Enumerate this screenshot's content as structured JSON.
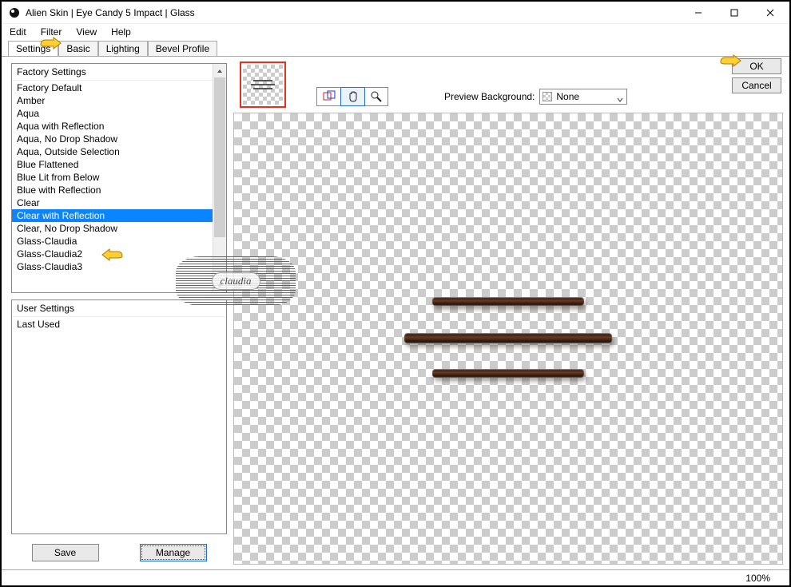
{
  "window": {
    "title": "Alien Skin | Eye Candy 5 Impact | Glass"
  },
  "menu": {
    "edit": "Edit",
    "filter": "Filter",
    "view": "View",
    "help": "Help"
  },
  "tabs": {
    "settings": "Settings",
    "basic": "Basic",
    "lighting": "Lighting",
    "bevel": "Bevel Profile"
  },
  "factory": {
    "header": "Factory Settings",
    "items": [
      "Factory Default",
      "Amber",
      "Aqua",
      "Aqua with Reflection",
      "Aqua, No Drop Shadow",
      "Aqua, Outside Selection",
      "Blue Flattened",
      "Blue Lit from Below",
      "Blue with Reflection",
      "Clear",
      "Clear with Reflection",
      "Clear, No Drop Shadow",
      "Glass-Claudia",
      "Glass-Claudia2",
      "Glass-Claudia3"
    ],
    "selected_index": 10
  },
  "user": {
    "header": "User Settings",
    "items": [
      "Last Used"
    ]
  },
  "buttons": {
    "save": "Save",
    "manage": "Manage",
    "ok": "OK",
    "cancel": "Cancel"
  },
  "preview": {
    "bg_label": "Preview Background:",
    "bg_value": "None"
  },
  "status": {
    "zoom": "100%"
  },
  "icons": {
    "nav": "navigator-icon",
    "hand": "hand-tool-icon",
    "zoom": "zoom-tool-icon"
  },
  "watermark": {
    "text": "claudia"
  }
}
